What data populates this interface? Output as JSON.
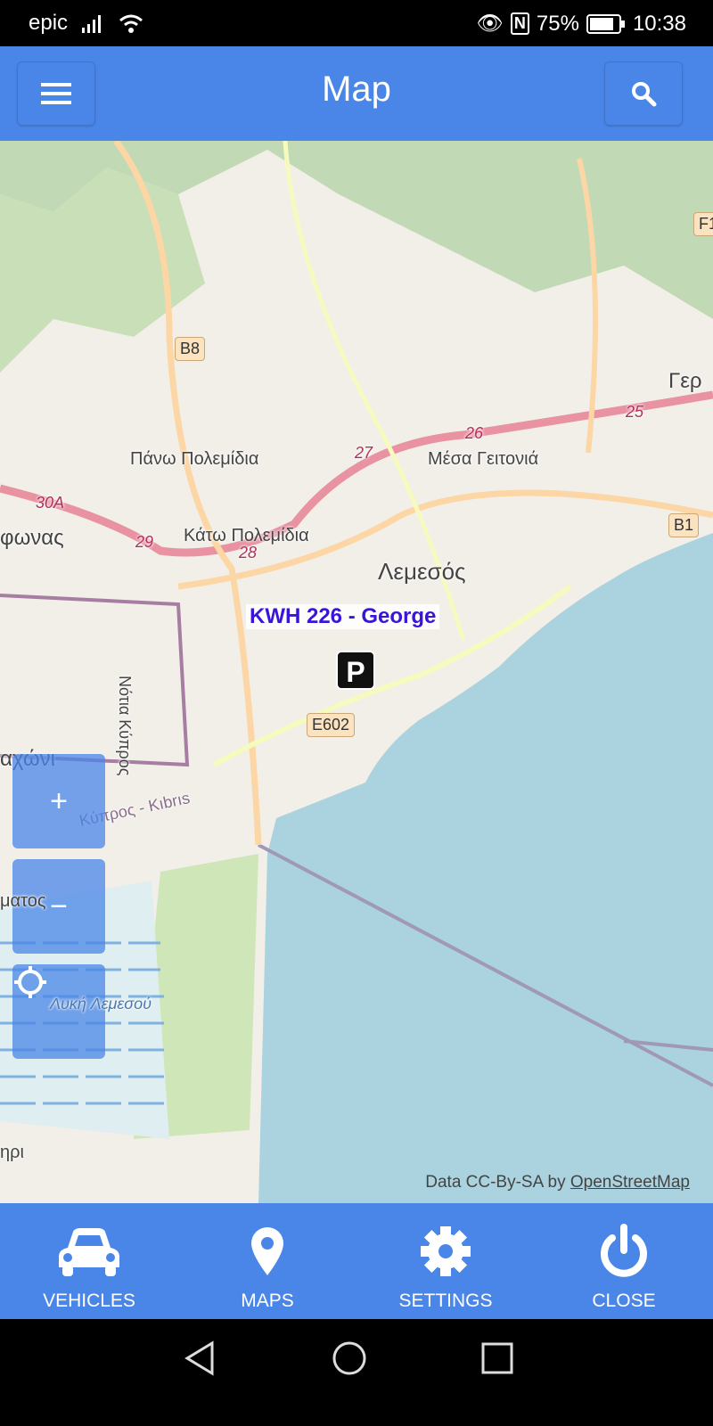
{
  "status_bar": {
    "carrier": "epic",
    "battery": "75%",
    "time": "10:38"
  },
  "header": {
    "title": "Map",
    "menu_icon": "hamburger-icon",
    "search_icon": "search-icon"
  },
  "map": {
    "labels": [
      "Πάνω Πολεμίδια",
      "Κάτω Πολεμίδια",
      "Μέσα Γειτονιά",
      "Λεμεσός",
      "φωνας",
      "αχώνι",
      "ματος",
      "Νότια Κύπρος",
      "Κύπρος - Kıbrıs",
      "Λυκή Λεμεσού",
      "Γερ",
      "ηρι"
    ],
    "road_refs": [
      "B8",
      "B1",
      "E602",
      "F1",
      "30A",
      "29",
      "28",
      "27",
      "26",
      "25"
    ],
    "vehicle_label": "KWH 226 - George",
    "parking_marker": "P",
    "zoom_in": "+",
    "zoom_out": "−",
    "attribution_prefix": "Data CC-By-SA by",
    "attribution_link": "OpenStreetMap",
    "colors": {
      "sea": "#aad3df",
      "land": "#f2efe9",
      "forest": "#add19e",
      "motorway": "#e892a2",
      "primary": "#fcd6a4",
      "accent": "#4a86e8",
      "vehicle_label": "#3a14d8"
    }
  },
  "bottom_nav": [
    {
      "label": "VEHICLES",
      "icon": "car-icon"
    },
    {
      "label": "MAPS",
      "icon": "map-pin-icon"
    },
    {
      "label": "SETTINGS",
      "icon": "gear-icon"
    },
    {
      "label": "CLOSE",
      "icon": "power-icon"
    }
  ]
}
